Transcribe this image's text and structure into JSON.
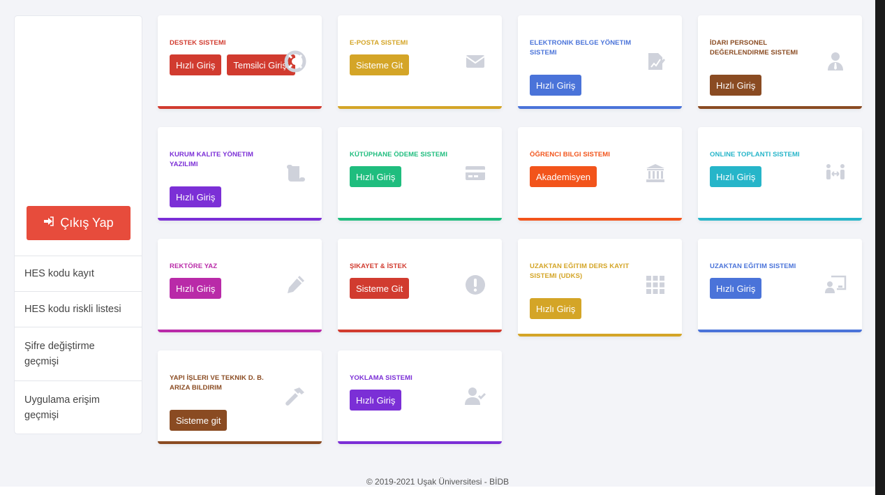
{
  "sidebar": {
    "logout_label": "Çıkış Yap",
    "items": [
      {
        "label": "HES kodu kayıt"
      },
      {
        "label": "HES kodu riskli listesi"
      },
      {
        "label": "Şifre değiştirme geçmişi"
      },
      {
        "label": "Uygulama erişim geçmişi"
      }
    ]
  },
  "cards": [
    {
      "title": "DESTEK SISTEMI",
      "color": "#d13b2f",
      "buttons": [
        "Hızlı Giriş",
        "Temsilci Girişi"
      ],
      "icon": "lifebuoy-icon"
    },
    {
      "title": "E-POSTA SISTEMI",
      "color": "#d4a527",
      "buttons": [
        "Sisteme Git"
      ],
      "icon": "envelope-icon"
    },
    {
      "title": "ELEKTRONIK BELGE YÖNETIM SISTEMI",
      "color": "#4a73d9",
      "buttons": [
        "Hızlı Giriş"
      ],
      "icon": "signature-icon"
    },
    {
      "title": "İDARI PERSONEL DEĞERLENDIRME SISTEMI",
      "color": "#8a4b22",
      "buttons": [
        "Hızlı Giriş"
      ],
      "icon": "user-tie-icon"
    },
    {
      "title": "KURUM KALITE YÖNETIM YAZILIMI",
      "color": "#7b2fd6",
      "buttons": [
        "Hızlı Giriş"
      ],
      "icon": "scroll-icon"
    },
    {
      "title": "KÜTÜPHANE ÖDEME SISTEMI",
      "color": "#1fbd7e",
      "buttons": [
        "Hızlı Giriş"
      ],
      "icon": "credit-card-icon"
    },
    {
      "title": "ÖĞRENCI BILGI SISTEMI",
      "color": "#f2541b",
      "buttons": [
        "Akademisyen"
      ],
      "icon": "university-icon"
    },
    {
      "title": "ONLINE TOPLANTI SISTEMI",
      "color": "#26b5c9",
      "buttons": [
        "Hızlı Giriş"
      ],
      "icon": "people-arrows-icon"
    },
    {
      "title": "REKTÖRE YAZ",
      "color": "#b92aa8",
      "buttons": [
        "Hızlı Giriş"
      ],
      "icon": "pencil-icon"
    },
    {
      "title": "ŞIKAYET & İSTEK",
      "color": "#d13b2f",
      "buttons": [
        "Sisteme Git"
      ],
      "icon": "exclamation-icon"
    },
    {
      "title": "UZAKTAN EĞITIM DERS KAYIT SISTEMI (UDKS)",
      "color": "#d4a527",
      "buttons": [
        "Hızlı Giriş"
      ],
      "icon": "grid-icon"
    },
    {
      "title": "UZAKTAN EĞITIM SISTEMI",
      "color": "#4a73d9",
      "buttons": [
        "Hızlı Giriş"
      ],
      "icon": "chalkboard-teacher-icon"
    },
    {
      "title": "YAPI İŞLERI VE TEKNIK D. B. ARIZA BILDIRIM",
      "color": "#8a4b22",
      "buttons": [
        "Sisteme git"
      ],
      "icon": "hammer-icon"
    },
    {
      "title": "YOKLAMA SISTEMI",
      "color": "#7b2fd6",
      "buttons": [
        "Hızlı Giriş"
      ],
      "icon": "user-check-icon"
    }
  ],
  "footer": {
    "text": "© 2019-2021 Uşak Üniversitesi - BİDB"
  }
}
